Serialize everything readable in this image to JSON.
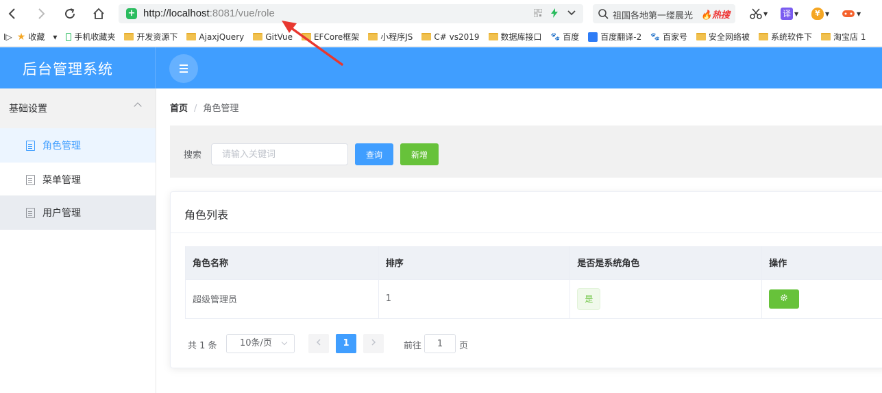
{
  "browser": {
    "url_host": "http://localhost",
    "url_rest": ":8081/vue/role",
    "search_text": "祖国各地第一缕晨光",
    "search_badge": "热搜",
    "ext_translate": "译",
    "ext_yuan": "¥"
  },
  "bookmarks": [
    {
      "label": "收藏",
      "icon": "star-icon"
    },
    {
      "label": "手机收藏夹",
      "icon": "phone-icon"
    },
    {
      "label": "开发资源下",
      "icon": "folder-icon"
    },
    {
      "label": "AjaxjQuery",
      "icon": "folder-icon"
    },
    {
      "label": "GitVue",
      "icon": "folder-icon"
    },
    {
      "label": "EFCore框架",
      "icon": "folder-icon"
    },
    {
      "label": "小程序JS",
      "icon": "folder-icon"
    },
    {
      "label": "C# vs2019",
      "icon": "folder-icon"
    },
    {
      "label": "数据库接口",
      "icon": "folder-icon"
    },
    {
      "label": "百度",
      "icon": "paw-icon"
    },
    {
      "label": "百度翻译-2",
      "icon": "translate-icon"
    },
    {
      "label": "百家号",
      "icon": "paw-icon"
    },
    {
      "label": "安全网络被",
      "icon": "folder-icon"
    },
    {
      "label": "系统软件下",
      "icon": "folder-icon"
    },
    {
      "label": "淘宝店 1",
      "icon": "folder-icon"
    }
  ],
  "header": {
    "title": "后台管理系统"
  },
  "sidebar": {
    "group_title": "基础设置",
    "items": [
      {
        "label": "角色管理",
        "state": "active"
      },
      {
        "label": "菜单管理",
        "state": "normal"
      },
      {
        "label": "用户管理",
        "state": "hover"
      }
    ]
  },
  "breadcrumb": {
    "home": "首页",
    "separator": "/",
    "current": "角色管理"
  },
  "search": {
    "label": "搜索",
    "placeholder": "请输入关键词",
    "query_button": "查询",
    "add_button": "新增"
  },
  "card": {
    "title": "角色列表"
  },
  "table": {
    "headers": [
      "角色名称",
      "排序",
      "是否是系统角色",
      "操作"
    ],
    "rows": [
      {
        "name": "超级管理员",
        "order": "1",
        "is_system": "是",
        "action_icon": "gear-icon"
      }
    ]
  },
  "pagination": {
    "total": "共 1 条",
    "page_size": "10条/页",
    "current_page": "1",
    "goto_label": "前往",
    "goto_value": "1",
    "page_unit": "页"
  },
  "colors": {
    "primary": "#409eff",
    "success": "#67c23a",
    "annotation_arrow": "#e8372f"
  }
}
